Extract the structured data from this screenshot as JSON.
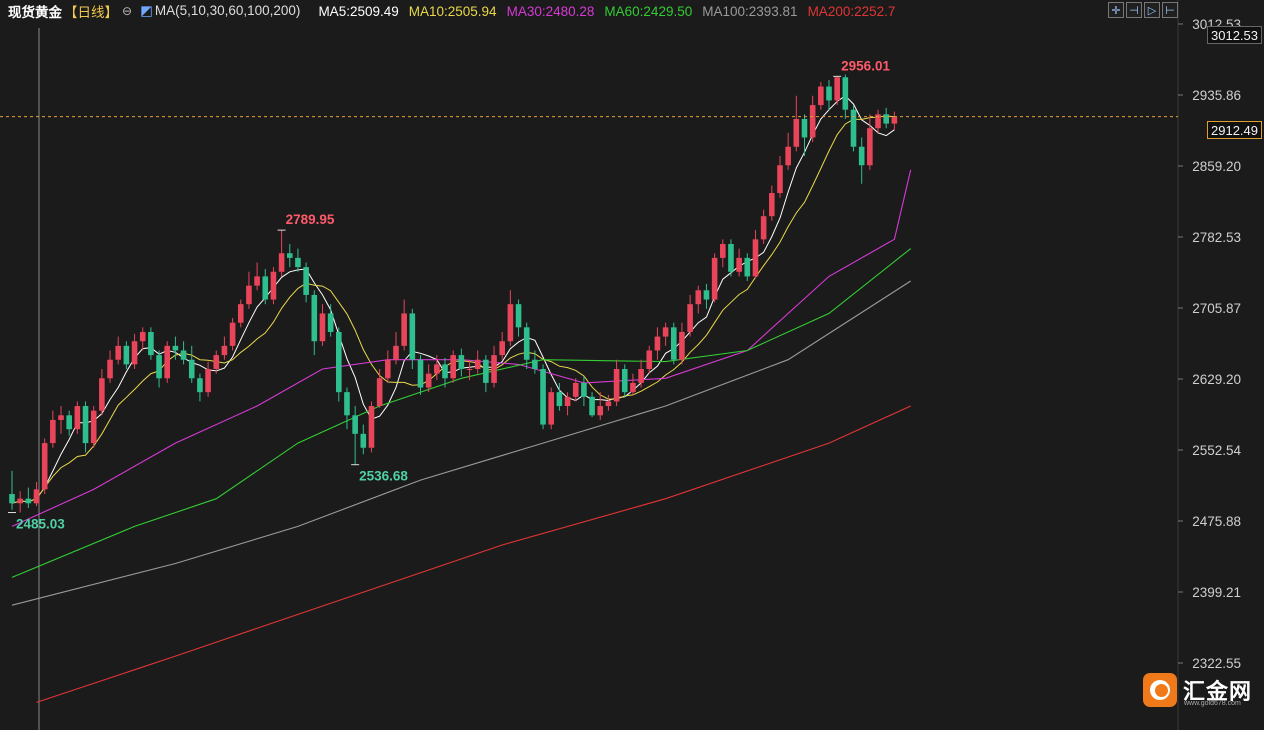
{
  "header": {
    "title": "现货黄金",
    "period": "【日线】",
    "ma_label": "MA(5,10,30,60,100,200)",
    "ma_values": [
      {
        "text": "MA5:2509.49",
        "color": "#ffffff"
      },
      {
        "text": "MA10:2505.94",
        "color": "#e8d84a"
      },
      {
        "text": "MA30:2480.28",
        "color": "#d63ad6"
      },
      {
        "text": "MA60:2429.50",
        "color": "#33cc33"
      },
      {
        "text": "MA100:2393.81",
        "color": "#9a9a9a"
      },
      {
        "text": "MA200:2252.7",
        "color": "#e03535"
      }
    ]
  },
  "toolbar": {
    "icons": [
      "crosshair-icon",
      "pan-left-icon",
      "play-icon",
      "pan-right-icon"
    ]
  },
  "current_price_label": "2912.49",
  "top_price_label": "3012.53",
  "logo": {
    "text": "汇金网",
    "url": "www.gold678.com"
  },
  "chart_data": {
    "type": "candlestick",
    "y_ticks": [
      "3012.53",
      "2935.86",
      "2859.20",
      "2782.53",
      "2705.87",
      "2629.20",
      "2552.54",
      "2475.88",
      "2399.21",
      "2322.55"
    ],
    "ylim": [
      2280,
      3030
    ],
    "current_price": 2912.49,
    "colors": {
      "up": "#e8455a",
      "down": "#2fbf8f",
      "bg": "#1b1b1b"
    },
    "annotations": [
      {
        "text": "2956.01",
        "value": 2956.01,
        "index": 101,
        "color": "#ff5a6a"
      },
      {
        "text": "2789.95",
        "value": 2789.95,
        "index": 33,
        "color": "#ff5a6a"
      },
      {
        "text": "2536.68",
        "value": 2536.68,
        "index": 42,
        "color": "#4fd1a5"
      },
      {
        "text": "2485.03",
        "value": 2485.03,
        "index": 0,
        "color": "#4fd1a5"
      }
    ],
    "candles": [
      [
        2505,
        2495,
        2530,
        2488
      ],
      [
        2495,
        2500,
        2508,
        2485
      ],
      [
        2500,
        2495,
        2512,
        2490
      ],
      [
        2495,
        2510,
        2518,
        2492
      ],
      [
        2510,
        2560,
        2565,
        2505
      ],
      [
        2560,
        2585,
        2595,
        2555
      ],
      [
        2585,
        2590,
        2600,
        2570
      ],
      [
        2590,
        2575,
        2595,
        2568
      ],
      [
        2575,
        2600,
        2605,
        2570
      ],
      [
        2600,
        2560,
        2605,
        2550
      ],
      [
        2560,
        2595,
        2600,
        2555
      ],
      [
        2595,
        2630,
        2640,
        2590
      ],
      [
        2630,
        2650,
        2660,
        2625
      ],
      [
        2650,
        2665,
        2675,
        2645
      ],
      [
        2665,
        2645,
        2670,
        2640
      ],
      [
        2645,
        2670,
        2678,
        2640
      ],
      [
        2670,
        2680,
        2685,
        2660
      ],
      [
        2680,
        2655,
        2685,
        2650
      ],
      [
        2655,
        2630,
        2660,
        2620
      ],
      [
        2630,
        2665,
        2670,
        2625
      ],
      [
        2665,
        2660,
        2675,
        2650
      ],
      [
        2660,
        2650,
        2670,
        2645
      ],
      [
        2650,
        2630,
        2665,
        2625
      ],
      [
        2630,
        2615,
        2635,
        2605
      ],
      [
        2615,
        2640,
        2648,
        2610
      ],
      [
        2640,
        2655,
        2660,
        2635
      ],
      [
        2655,
        2665,
        2675,
        2650
      ],
      [
        2665,
        2690,
        2695,
        2660
      ],
      [
        2690,
        2710,
        2715,
        2685
      ],
      [
        2710,
        2730,
        2745,
        2705
      ],
      [
        2730,
        2740,
        2755,
        2725
      ],
      [
        2740,
        2715,
        2748,
        2710
      ],
      [
        2715,
        2745,
        2750,
        2710
      ],
      [
        2745,
        2765,
        2790,
        2740
      ],
      [
        2765,
        2760,
        2775,
        2750
      ],
      [
        2760,
        2750,
        2770,
        2745
      ],
      [
        2750,
        2720,
        2755,
        2712
      ],
      [
        2720,
        2670,
        2725,
        2655
      ],
      [
        2670,
        2700,
        2710,
        2665
      ],
      [
        2700,
        2680,
        2710,
        2675
      ],
      [
        2680,
        2615,
        2685,
        2605
      ],
      [
        2615,
        2590,
        2620,
        2575
      ],
      [
        2590,
        2570,
        2600,
        2537
      ],
      [
        2570,
        2555,
        2580,
        2548
      ],
      [
        2555,
        2600,
        2605,
        2550
      ],
      [
        2600,
        2630,
        2640,
        2598
      ],
      [
        2630,
        2650,
        2660,
        2625
      ],
      [
        2650,
        2665,
        2680,
        2645
      ],
      [
        2665,
        2700,
        2715,
        2660
      ],
      [
        2700,
        2650,
        2705,
        2640
      ],
      [
        2650,
        2620,
        2655,
        2612
      ],
      [
        2620,
        2635,
        2645,
        2615
      ],
      [
        2635,
        2645,
        2655,
        2628
      ],
      [
        2645,
        2630,
        2652,
        2620
      ],
      [
        2630,
        2655,
        2660,
        2625
      ],
      [
        2655,
        2640,
        2662,
        2632
      ],
      [
        2640,
        2640,
        2650,
        2628
      ],
      [
        2640,
        2650,
        2660,
        2635
      ],
      [
        2650,
        2625,
        2655,
        2615
      ],
      [
        2625,
        2655,
        2665,
        2620
      ],
      [
        2655,
        2670,
        2680,
        2650
      ],
      [
        2670,
        2710,
        2725,
        2665
      ],
      [
        2710,
        2685,
        2715,
        2675
      ],
      [
        2685,
        2650,
        2690,
        2640
      ],
      [
        2650,
        2640,
        2660,
        2635
      ],
      [
        2640,
        2580,
        2645,
        2575
      ],
      [
        2580,
        2615,
        2620,
        2575
      ],
      [
        2615,
        2600,
        2625,
        2595
      ],
      [
        2600,
        2610,
        2615,
        2590
      ],
      [
        2610,
        2625,
        2630,
        2605
      ],
      [
        2625,
        2610,
        2632,
        2600
      ],
      [
        2610,
        2590,
        2615,
        2588
      ],
      [
        2590,
        2600,
        2615,
        2585
      ],
      [
        2600,
        2605,
        2612,
        2595
      ],
      [
        2605,
        2640,
        2650,
        2600
      ],
      [
        2640,
        2615,
        2645,
        2610
      ],
      [
        2615,
        2625,
        2635,
        2612
      ],
      [
        2625,
        2640,
        2650,
        2620
      ],
      [
        2640,
        2660,
        2665,
        2635
      ],
      [
        2660,
        2675,
        2685,
        2650
      ],
      [
        2675,
        2685,
        2690,
        2665
      ],
      [
        2685,
        2650,
        2690,
        2645
      ],
      [
        2650,
        2680,
        2690,
        2645
      ],
      [
        2680,
        2710,
        2720,
        2675
      ],
      [
        2710,
        2725,
        2730,
        2700
      ],
      [
        2725,
        2715,
        2732,
        2705
      ],
      [
        2715,
        2760,
        2765,
        2712
      ],
      [
        2760,
        2775,
        2780,
        2750
      ],
      [
        2775,
        2745,
        2780,
        2740
      ],
      [
        2745,
        2760,
        2770,
        2740
      ],
      [
        2760,
        2740,
        2765,
        2735
      ],
      [
        2740,
        2780,
        2790,
        2738
      ],
      [
        2780,
        2805,
        2812,
        2775
      ],
      [
        2805,
        2830,
        2838,
        2800
      ],
      [
        2830,
        2860,
        2870,
        2825
      ],
      [
        2860,
        2880,
        2895,
        2855
      ],
      [
        2880,
        2910,
        2935,
        2875
      ],
      [
        2910,
        2890,
        2915,
        2870
      ],
      [
        2890,
        2925,
        2935,
        2885
      ],
      [
        2925,
        2945,
        2950,
        2920
      ],
      [
        2945,
        2930,
        2952,
        2920
      ],
      [
        2930,
        2955,
        2956,
        2925
      ],
      [
        2955,
        2920,
        2958,
        2910
      ],
      [
        2920,
        2880,
        2925,
        2875
      ],
      [
        2880,
        2860,
        2890,
        2840
      ],
      [
        2860,
        2900,
        2915,
        2855
      ],
      [
        2900,
        2915,
        2920,
        2895
      ],
      [
        2915,
        2905,
        2922,
        2900
      ],
      [
        2905,
        2912,
        2918,
        2898
      ]
    ]
  }
}
